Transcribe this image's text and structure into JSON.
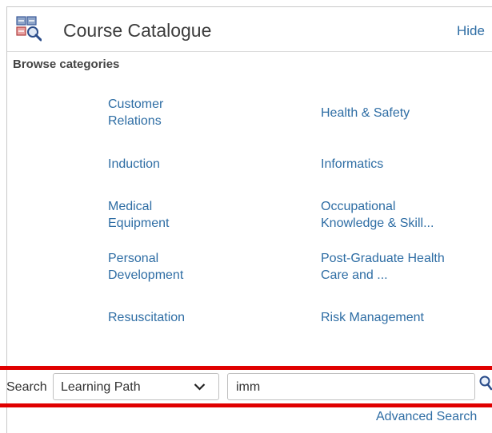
{
  "header": {
    "title": "Course Catalogue",
    "hide_label": "Hide",
    "icon": "catalogue-icon"
  },
  "browse": {
    "heading": "Browse categories",
    "categories": [
      {
        "label": "Customer\nRelations"
      },
      {
        "label": "Health & Safety"
      },
      {
        "label": "Induction"
      },
      {
        "label": "Informatics"
      },
      {
        "label": "Medical\nEquipment"
      },
      {
        "label": "Occupational\nKnowledge & Skill..."
      },
      {
        "label": "Personal\nDevelopment"
      },
      {
        "label": "Post-Graduate Health\nCare and ..."
      },
      {
        "label": "Resuscitation"
      },
      {
        "label": "Risk Management"
      }
    ]
  },
  "search": {
    "label": "Search",
    "type_selected": "Learning Path",
    "query": "imm",
    "advanced_label": "Advanced Search"
  },
  "colors": {
    "link": "#2e6da4",
    "highlight": "#e00000"
  }
}
